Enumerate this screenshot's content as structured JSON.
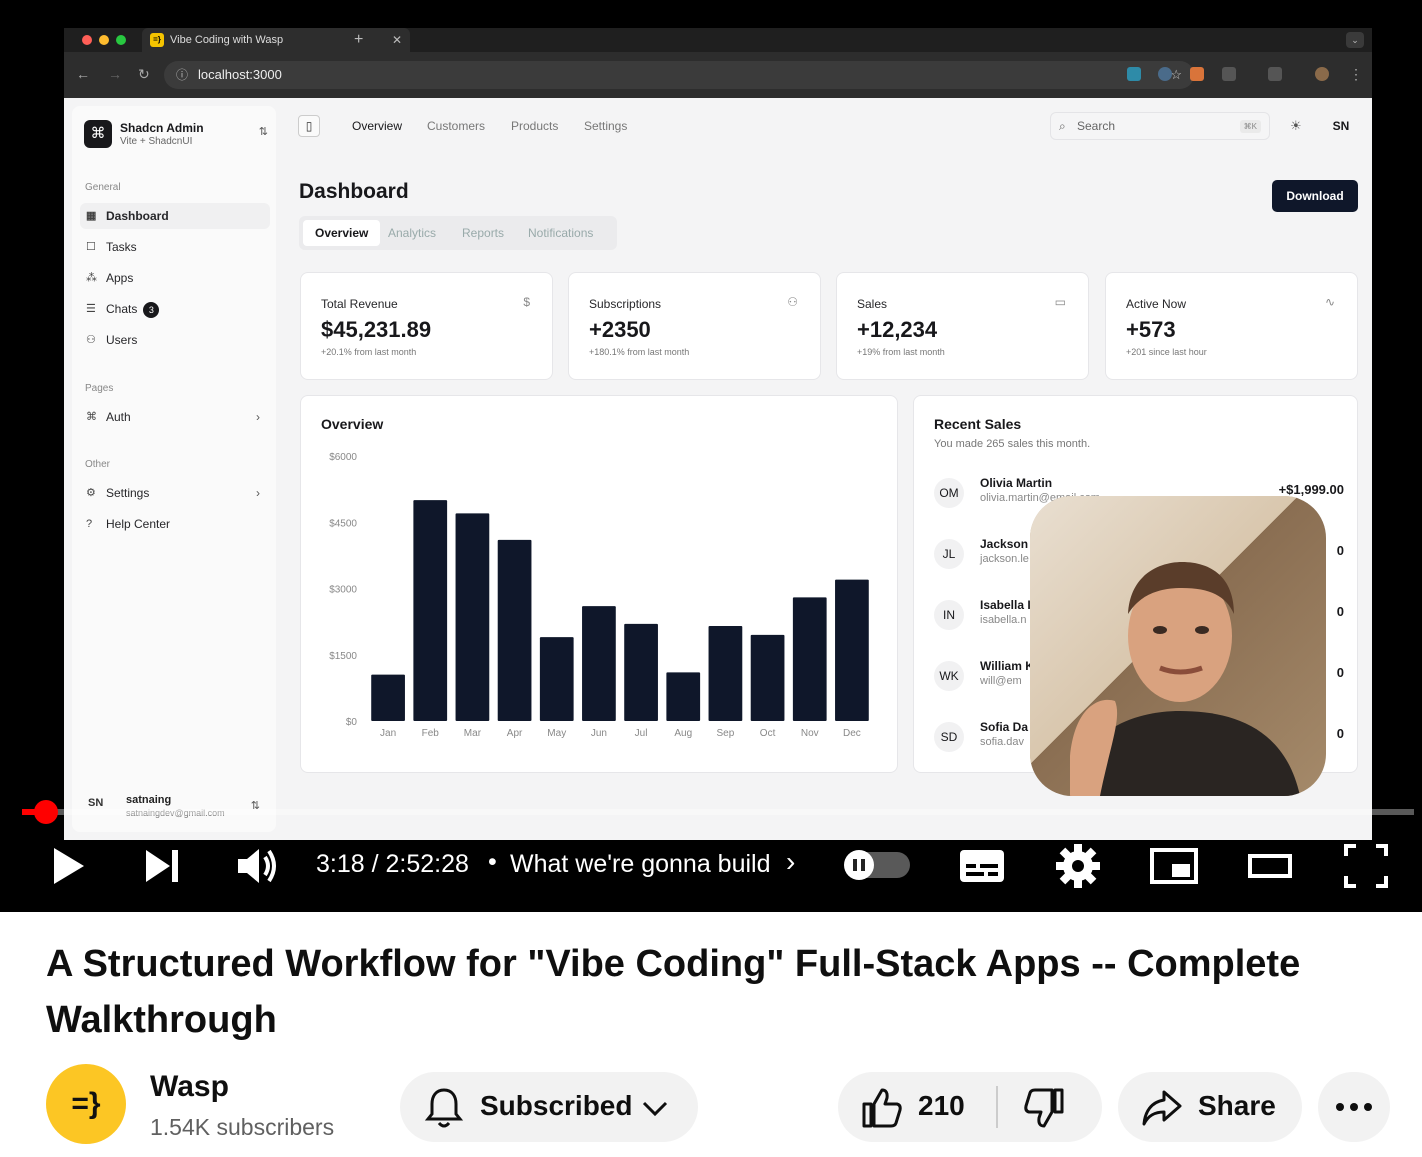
{
  "browser": {
    "tab_title": "Vibe Coding with Wasp",
    "url": "localhost:3000"
  },
  "app": {
    "team": {
      "name": "Shadcn Admin",
      "plan": "Vite + ShadcnUI"
    },
    "sidebar": {
      "groups": [
        {
          "label": "General",
          "items": [
            {
              "label": "Dashboard",
              "active": true
            },
            {
              "label": "Tasks"
            },
            {
              "label": "Apps"
            },
            {
              "label": "Chats",
              "badge": "3"
            },
            {
              "label": "Users"
            }
          ]
        },
        {
          "label": "Pages",
          "items": [
            {
              "label": "Auth"
            }
          ]
        },
        {
          "label": "Other",
          "items": [
            {
              "label": "Settings"
            },
            {
              "label": "Help Center"
            }
          ]
        }
      ],
      "user": {
        "initials": "SN",
        "name": "satnaing",
        "email": "satnaingdev@gmail.com"
      }
    },
    "topnav": {
      "links": [
        "Overview",
        "Customers",
        "Products",
        "Settings"
      ],
      "search_placeholder": "Search",
      "search_shortcut": "⌘K",
      "avatar": "SN"
    },
    "title": "Dashboard",
    "download_label": "Download",
    "tabs": [
      "Overview",
      "Analytics",
      "Reports",
      "Notifications"
    ],
    "stats": [
      {
        "title": "Total Revenue",
        "icon": "dollar-icon",
        "value": "$45,231.89",
        "sub": "+20.1% from last month"
      },
      {
        "title": "Subscriptions",
        "icon": "users-icon",
        "value": "+2350",
        "sub": "+180.1% from last month"
      },
      {
        "title": "Sales",
        "icon": "credit-card-icon",
        "value": "+12,234",
        "sub": "+19% from last month"
      },
      {
        "title": "Active Now",
        "icon": "activity-icon",
        "value": "+573",
        "sub": "+201 since last hour"
      }
    ],
    "overview_title": "Overview",
    "recent": {
      "title": "Recent Sales",
      "subtitle": "You made 265 sales this month.",
      "items": [
        {
          "initials": "OM",
          "name": "Olivia Martin",
          "email": "olivia.martin@email.com",
          "amount": "+$1,999.00"
        },
        {
          "initials": "JL",
          "name": "Jackson L",
          "email": "jackson.le",
          "amount": "0"
        },
        {
          "initials": "IN",
          "name": "Isabella I",
          "email": "isabella.n",
          "amount": "0"
        },
        {
          "initials": "WK",
          "name": "William K",
          "email": "will@em",
          "amount": "0"
        },
        {
          "initials": "SD",
          "name": "Sofia Da",
          "email": "sofia.dav",
          "amount": "0"
        }
      ]
    }
  },
  "chart_data": {
    "type": "bar",
    "categories": [
      "Jan",
      "Feb",
      "Mar",
      "Apr",
      "May",
      "Jun",
      "Jul",
      "Aug",
      "Sep",
      "Oct",
      "Nov",
      "Dec"
    ],
    "values": [
      1050,
      5000,
      4700,
      4100,
      1900,
      2600,
      2200,
      1100,
      2150,
      1950,
      2800,
      3200
    ],
    "yticks": [
      "$0",
      "$1500",
      "$3000",
      "$4500",
      "$6000"
    ],
    "ylim": [
      0,
      6000
    ],
    "bar_color": "#0f172a"
  },
  "player": {
    "current_time": "3:18",
    "duration": "2:52:28",
    "time_display": "3:18 / 2:52:28",
    "chapter": "What we're gonna build",
    "progress": 0.019
  },
  "video": {
    "title": "A Structured Workflow for \"Vibe Coding\" Full-Stack Apps -- Complete Walkthrough",
    "channel": "Wasp",
    "channel_logo": "=}",
    "subscribers": "1.54K subscribers",
    "subscribe_label": "Subscribed",
    "likes": "210",
    "share_label": "Share"
  },
  "colors": {
    "accent": "#ff0000",
    "channel_logo_bg": "#fcc624",
    "primary": "#0f172a"
  }
}
